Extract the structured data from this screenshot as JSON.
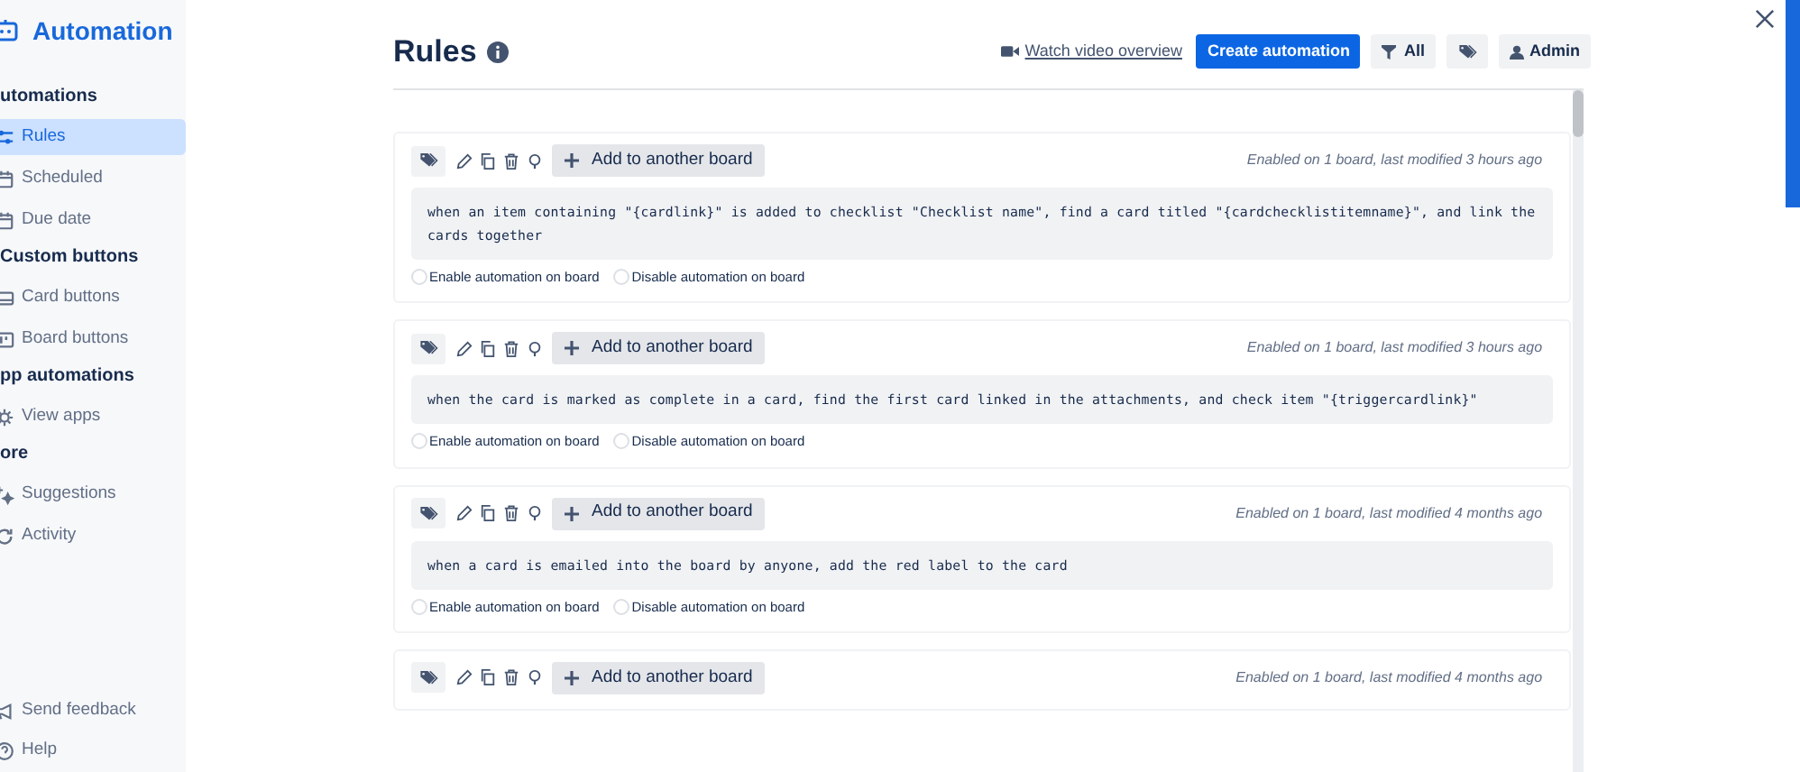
{
  "sidebar": {
    "title": "Automation",
    "sections": [
      {
        "heading": "utomations",
        "items": [
          {
            "label": "Rules",
            "kind": "sliders",
            "selected": true
          },
          {
            "label": "Scheduled",
            "kind": "calendar",
            "selected": false
          },
          {
            "label": "Due date",
            "kind": "calendar",
            "selected": false
          }
        ]
      },
      {
        "heading": "Custom buttons",
        "items": [
          {
            "label": "Card buttons",
            "kind": "card",
            "selected": false
          },
          {
            "label": "Board buttons",
            "kind": "board",
            "selected": false
          }
        ]
      },
      {
        "heading": "pp automations",
        "items": [
          {
            "label": "View apps",
            "kind": "gear",
            "selected": false
          }
        ]
      },
      {
        "heading": "ore",
        "items": [
          {
            "label": "Suggestions",
            "kind": "sparkle",
            "selected": false
          },
          {
            "label": "Activity",
            "kind": "refresh",
            "selected": false
          }
        ]
      }
    ],
    "footer": [
      {
        "label": "Send feedback",
        "kind": "megaphone"
      },
      {
        "label": "Help",
        "kind": "help"
      }
    ]
  },
  "header": {
    "title": "Rules",
    "video_link": "Watch video overview",
    "create_button": "Create automation",
    "filter_button": "All",
    "admin_button": "Admin"
  },
  "rules": [
    {
      "add_button": "Add to another board",
      "meta": "Enabled on 1 board, last modified 3 hours ago",
      "text": "when an item containing \"{cardlink}\" is added to checklist \"Checklist name\", find a card titled \"{cardchecklistitemname}\", and link the cards together",
      "enable": "Enable automation on board",
      "disable": "Disable automation on board"
    },
    {
      "add_button": "Add to another board",
      "meta": "Enabled on 1 board, last modified 3 hours ago",
      "text": "when the card is marked as complete in a card, find the first card linked in the attachments, and check item \"{triggercardlink}\"",
      "enable": "Enable automation on board",
      "disable": "Disable automation on board"
    },
    {
      "add_button": "Add to another board",
      "meta": "Enabled on 1 board, last modified 4 months ago",
      "text": "when a card is emailed into the board by anyone, add the red label to the card",
      "enable": "Enable automation on board",
      "disable": "Disable automation on board"
    },
    {
      "add_button": "Add to another board",
      "meta": "Enabled on 1 board, last modified 4 months ago"
    }
  ]
}
